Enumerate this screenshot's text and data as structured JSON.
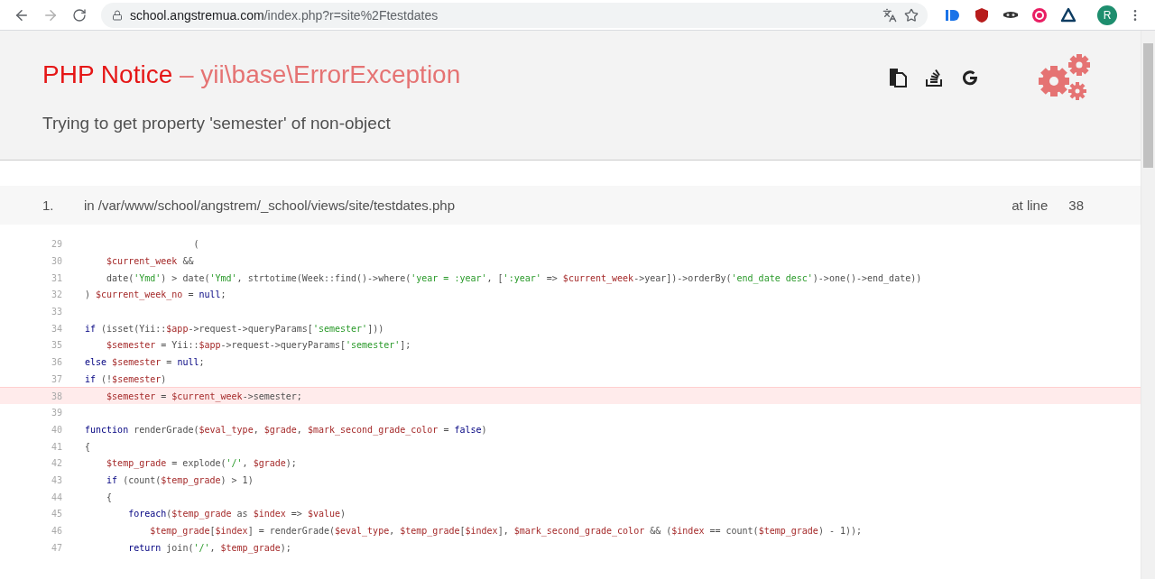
{
  "browser": {
    "url_host": "school.angstremua.com",
    "url_path": "/index.php?r=site%2Ftestdates",
    "avatar": "R"
  },
  "error": {
    "name": "PHP Notice",
    "exception": "– yii\\base\\ErrorException",
    "message": "Trying to get property 'semester' of non-object"
  },
  "frames": [
    {
      "number": "1.",
      "file": "in /var/www/school/angstrem/_school/views/site/testdates.php",
      "at_label": "at line",
      "line": "38",
      "code": [
        {
          "number": "29",
          "highlighted": false,
          "tokens": [
            {
              "kind": "plain",
              "text": "                    ("
            }
          ]
        },
        {
          "number": "30",
          "highlighted": false,
          "tokens": [
            {
              "kind": "var",
              "text": "    $current_week"
            },
            {
              "kind": "plain",
              "text": " &&"
            }
          ]
        },
        {
          "number": "31",
          "highlighted": false,
          "tokens": [
            {
              "kind": "plain",
              "text": "    date("
            },
            {
              "kind": "string",
              "text": "'Ymd'"
            },
            {
              "kind": "plain",
              "text": ") > date("
            },
            {
              "kind": "string",
              "text": "'Ymd'"
            },
            {
              "kind": "plain",
              "text": ", strtotime(Week::find()->where("
            },
            {
              "kind": "string",
              "text": "'year = :year'"
            },
            {
              "kind": "plain",
              "text": ", ["
            },
            {
              "kind": "string",
              "text": "':year'"
            },
            {
              "kind": "plain",
              "text": " => "
            },
            {
              "kind": "var",
              "text": "$current_week"
            },
            {
              "kind": "plain",
              "text": "->year])->orderBy("
            },
            {
              "kind": "string",
              "text": "'end_date desc'"
            },
            {
              "kind": "plain",
              "text": ")->one()->end_date))"
            }
          ]
        },
        {
          "number": "32",
          "highlighted": false,
          "tokens": [
            {
              "kind": "plain",
              "text": ") "
            },
            {
              "kind": "var",
              "text": "$current_week_no"
            },
            {
              "kind": "plain",
              "text": " = "
            },
            {
              "kind": "keyword",
              "text": "null"
            },
            {
              "kind": "plain",
              "text": ";"
            }
          ]
        },
        {
          "number": "33",
          "highlighted": false
        },
        {
          "number": "34",
          "highlighted": false,
          "tokens": [
            {
              "kind": "keyword",
              "text": "if"
            },
            {
              "kind": "plain",
              "text": " (isset(Yii::"
            },
            {
              "kind": "var",
              "text": "$app"
            },
            {
              "kind": "plain",
              "text": "->request->queryParams["
            },
            {
              "kind": "string",
              "text": "'semester'"
            },
            {
              "kind": "plain",
              "text": "]))"
            }
          ]
        },
        {
          "number": "35",
          "highlighted": false,
          "tokens": [
            {
              "kind": "var",
              "text": "    $semester"
            },
            {
              "kind": "plain",
              "text": " = Yii::"
            },
            {
              "kind": "var",
              "text": "$app"
            },
            {
              "kind": "plain",
              "text": "->request->queryParams["
            },
            {
              "kind": "string",
              "text": "'semester'"
            },
            {
              "kind": "plain",
              "text": "];"
            }
          ]
        },
        {
          "number": "36",
          "highlighted": false,
          "tokens": [
            {
              "kind": "keyword",
              "text": "else"
            },
            {
              "kind": "var",
              "text": " $semester"
            },
            {
              "kind": "plain",
              "text": " = "
            },
            {
              "kind": "keyword",
              "text": "null"
            },
            {
              "kind": "plain",
              "text": ";"
            }
          ]
        },
        {
          "number": "37",
          "highlighted": false,
          "tokens": [
            {
              "kind": "keyword",
              "text": "if"
            },
            {
              "kind": "plain",
              "text": " (!"
            },
            {
              "kind": "var",
              "text": "$semester"
            },
            {
              "kind": "plain",
              "text": ")"
            }
          ]
        },
        {
          "number": "38",
          "highlighted": true,
          "tokens": [
            {
              "kind": "var",
              "text": "    $semester"
            },
            {
              "kind": "plain",
              "text": " = "
            },
            {
              "kind": "var",
              "text": "$current_week"
            },
            {
              "kind": "plain",
              "text": "->semester;"
            }
          ]
        },
        {
          "number": "39",
          "highlighted": false
        },
        {
          "number": "40",
          "highlighted": false,
          "tokens": [
            {
              "kind": "keyword",
              "text": "function"
            },
            {
              "kind": "plain",
              "text": " renderGrade("
            },
            {
              "kind": "var",
              "text": "$eval_type"
            },
            {
              "kind": "plain",
              "text": ", "
            },
            {
              "kind": "var",
              "text": "$grade"
            },
            {
              "kind": "plain",
              "text": ", "
            },
            {
              "kind": "var",
              "text": "$mark_second_grade_color"
            },
            {
              "kind": "plain",
              "text": " = "
            },
            {
              "kind": "keyword",
              "text": "false"
            },
            {
              "kind": "plain",
              "text": ")"
            }
          ]
        },
        {
          "number": "41",
          "highlighted": false,
          "tokens": [
            {
              "kind": "plain",
              "text": "{"
            }
          ]
        },
        {
          "number": "42",
          "highlighted": false,
          "tokens": [
            {
              "kind": "var",
              "text": "    $temp_grade"
            },
            {
              "kind": "plain",
              "text": " = explode("
            },
            {
              "kind": "string",
              "text": "'/'"
            },
            {
              "kind": "plain",
              "text": ", "
            },
            {
              "kind": "var",
              "text": "$grade"
            },
            {
              "kind": "plain",
              "text": ");"
            }
          ]
        },
        {
          "number": "43",
          "highlighted": false,
          "tokens": [
            {
              "kind": "keyword",
              "text": "    if"
            },
            {
              "kind": "plain",
              "text": " (count("
            },
            {
              "kind": "var",
              "text": "$temp_grade"
            },
            {
              "kind": "plain",
              "text": ") > 1)"
            }
          ]
        },
        {
          "number": "44",
          "highlighted": false,
          "tokens": [
            {
              "kind": "plain",
              "text": "    {"
            }
          ]
        },
        {
          "number": "45",
          "highlighted": false,
          "tokens": [
            {
              "kind": "keyword",
              "text": "        foreach"
            },
            {
              "kind": "plain",
              "text": "("
            },
            {
              "kind": "var",
              "text": "$temp_grade"
            },
            {
              "kind": "plain",
              "text": " as "
            },
            {
              "kind": "var",
              "text": "$index"
            },
            {
              "kind": "plain",
              "text": " => "
            },
            {
              "kind": "var",
              "text": "$value"
            },
            {
              "kind": "plain",
              "text": ")"
            }
          ]
        },
        {
          "number": "46",
          "highlighted": false,
          "tokens": [
            {
              "kind": "var",
              "text": "            $temp_grade"
            },
            {
              "kind": "plain",
              "text": "["
            },
            {
              "kind": "var",
              "text": "$index"
            },
            {
              "kind": "plain",
              "text": "] = renderGrade("
            },
            {
              "kind": "var",
              "text": "$eval_type"
            },
            {
              "kind": "plain",
              "text": ", "
            },
            {
              "kind": "var",
              "text": "$temp_grade"
            },
            {
              "kind": "plain",
              "text": "["
            },
            {
              "kind": "var",
              "text": "$index"
            },
            {
              "kind": "plain",
              "text": "], "
            },
            {
              "kind": "var",
              "text": "$mark_second_grade_color"
            },
            {
              "kind": "plain",
              "text": " && ("
            },
            {
              "kind": "var",
              "text": "$index"
            },
            {
              "kind": "plain",
              "text": " == count("
            },
            {
              "kind": "var",
              "text": "$temp_grade"
            },
            {
              "kind": "plain",
              "text": ") - 1));"
            }
          ]
        },
        {
          "number": "47",
          "highlighted": false,
          "tokens": [
            {
              "kind": "keyword",
              "text": "        return"
            },
            {
              "kind": "plain",
              "text": " join("
            },
            {
              "kind": "string",
              "text": "'/'"
            },
            {
              "kind": "plain",
              "text": ", "
            },
            {
              "kind": "var",
              "text": "$temp_grade"
            },
            {
              "kind": "plain",
              "text": ");"
            }
          ]
        }
      ]
    }
  ]
}
